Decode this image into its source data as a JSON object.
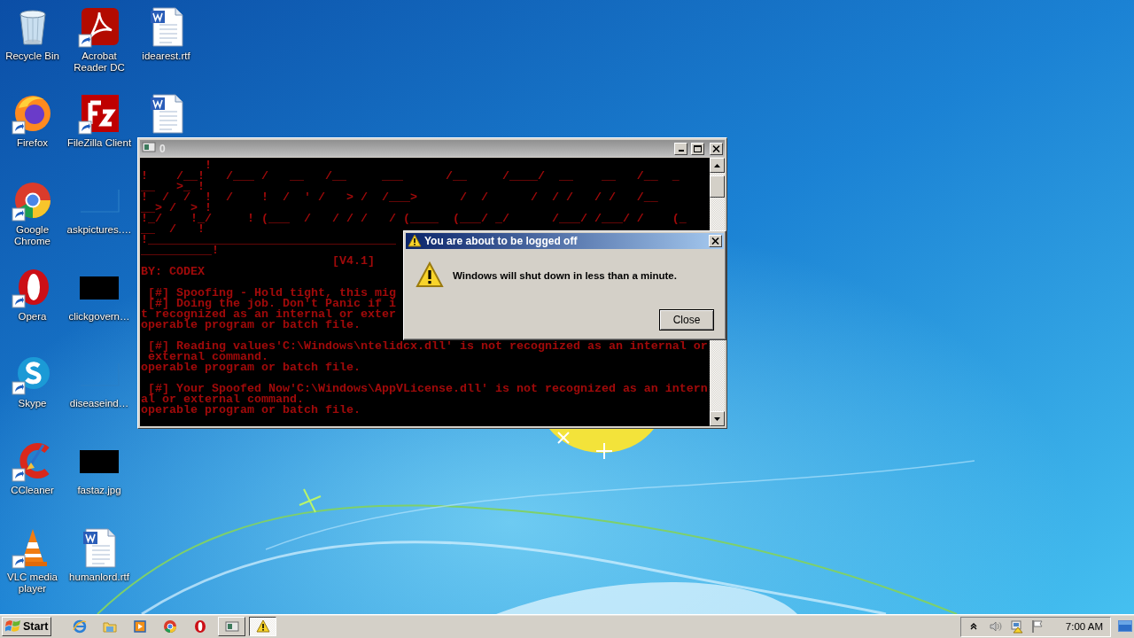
{
  "desktop": {
    "icons": [
      {
        "label": "Recycle Bin",
        "kind": "recycle",
        "shortcut": false
      },
      {
        "label": "Firefox",
        "kind": "firefox",
        "shortcut": true
      },
      {
        "label": "Google Chrome",
        "kind": "chrome",
        "shortcut": true
      },
      {
        "label": "Opera",
        "kind": "opera",
        "shortcut": true
      },
      {
        "label": "Skype",
        "kind": "skype",
        "shortcut": true
      },
      {
        "label": "CCleaner",
        "kind": "ccleaner",
        "shortcut": true
      },
      {
        "label": "VLC media player",
        "kind": "vlc",
        "shortcut": true
      },
      {
        "label": "Acrobat Reader DC",
        "kind": "acrobat",
        "shortcut": true
      },
      {
        "label": "FileZilla Client",
        "kind": "filezilla",
        "shortcut": true
      },
      {
        "label": "askpictures.…",
        "kind": "thumb-light",
        "shortcut": false
      },
      {
        "label": "clickgovern…",
        "kind": "thumb-dark",
        "shortcut": false
      },
      {
        "label": "diseaseind…",
        "kind": "thumb-light",
        "shortcut": false
      },
      {
        "label": "fastaz.jpg",
        "kind": "thumb-dark",
        "shortcut": false
      },
      {
        "label": "humanlord.rtf",
        "kind": "word",
        "shortcut": false
      },
      {
        "label": "idearest.rtf",
        "kind": "word",
        "shortcut": false
      },
      {
        "kind": "word",
        "shortcut": false
      }
    ]
  },
  "console_window": {
    "title": "0",
    "lines": [
      {
        "text": "         !",
        "gap_before": false
      },
      {
        "text": "!    /__!   /___ /   __   /__     ___      /__     /____/  __    __   /__  _",
        "gap_before": false
      },
      {
        "text": "__   >_ !",
        "gap_before": false
      },
      {
        "text": "!  /  /  !  /    !  /  ' /   > /  /___>      /  /      /  / /   / /   /__",
        "gap_before": false
      },
      {
        "text": "__> /  > !",
        "gap_before": false
      },
      {
        "text": "!_/    !_/     ! (___  /   / / /   / (____  (___/ _/      /___/ /___/ /    (_",
        "gap_before": false
      },
      {
        "text": "__  /   !",
        "gap_before": false
      },
      {
        "text": "!___________________________________",
        "gap_before": false
      },
      {
        "text": "__________!",
        "gap_before": false
      },
      {
        "text": "                           [V4.1]",
        "gap_before": false
      },
      {
        "text": "BY: CODEX",
        "gap_before": false
      },
      {
        "text": " [#] Spoofing - Hold tight, this mig",
        "gap_before": true
      },
      {
        "text": " [#] Doing the job. Don't Panic if i",
        "gap_before": false
      },
      {
        "text": "t recognized as an internal or exter",
        "gap_before": false
      },
      {
        "text": "operable program or batch file.",
        "gap_before": false
      },
      {
        "text": " [#] Reading values'C:\\Windows\\ntelidcx.dll' is not recognized as an internal or",
        "gap_before": true
      },
      {
        "text": " external command.",
        "gap_before": false
      },
      {
        "text": "operable program or batch file.",
        "gap_before": false
      },
      {
        "text": " [#] Your Spoofed Now'C:\\Windows\\AppVLicense.dll' is not recognized as an intern",
        "gap_before": true
      },
      {
        "text": "al or external command.",
        "gap_before": false
      },
      {
        "text": "operable program or batch file.",
        "gap_before": false
      }
    ]
  },
  "dialog": {
    "title": "You are about to be logged off",
    "message": "Windows will shut down in less than a minute.",
    "button": "Close"
  },
  "taskbar": {
    "start": "Start",
    "quick_launch": [
      {
        "kind": "ie"
      },
      {
        "kind": "folder"
      },
      {
        "kind": "media"
      },
      {
        "kind": "chrome"
      },
      {
        "kind": "opera"
      }
    ],
    "tasks": [
      {
        "kind": "console",
        "selected": false
      },
      {
        "kind": "warning",
        "selected": true
      }
    ],
    "tray": [
      {
        "kind": "chevron"
      },
      {
        "kind": "speaker"
      },
      {
        "kind": "network"
      },
      {
        "kind": "flag"
      }
    ],
    "clock": "7:00 AM"
  }
}
